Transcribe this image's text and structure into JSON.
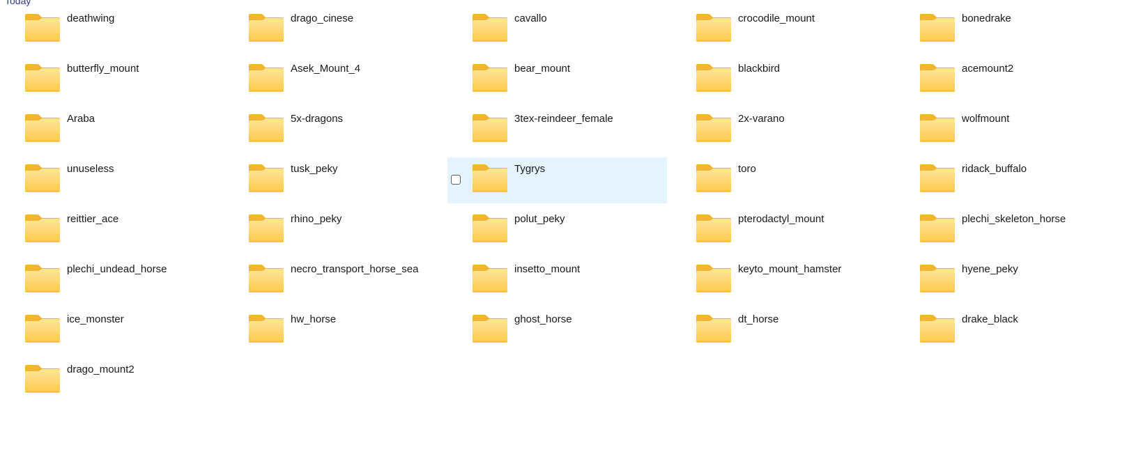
{
  "group": {
    "header": "Today"
  },
  "colors": {
    "folder_back": "#f2b52e",
    "folder_front_top": "#ffe69a",
    "folder_front_bottom": "#fcc94a",
    "selection_bg": "#e5f3fd",
    "header_text": "#2b3f8e"
  },
  "folders": [
    {
      "name": "deathwing"
    },
    {
      "name": "drago_cinese"
    },
    {
      "name": "cavallo"
    },
    {
      "name": "crocodile_mount"
    },
    {
      "name": "bonedrake"
    },
    {
      "name": "butterfly_mount"
    },
    {
      "name": "Asek_Mount_4"
    },
    {
      "name": "bear_mount"
    },
    {
      "name": "blackbird"
    },
    {
      "name": "acemount2"
    },
    {
      "name": "Araba"
    },
    {
      "name": "5x-dragons"
    },
    {
      "name": "3tex-reindeer_female"
    },
    {
      "name": "2x-varano"
    },
    {
      "name": "wolfmount"
    },
    {
      "name": "unuseless"
    },
    {
      "name": "tusk_peky"
    },
    {
      "name": "Tygrys",
      "selected": true
    },
    {
      "name": "toro"
    },
    {
      "name": "ridack_buffalo"
    },
    {
      "name": "reittier_ace"
    },
    {
      "name": "rhino_peky"
    },
    {
      "name": "polut_peky"
    },
    {
      "name": "pterodactyl_mount"
    },
    {
      "name": "plechi_skeleton_horse"
    },
    {
      "name": "plechi_undead_horse"
    },
    {
      "name": "necro_transport_horse_sea"
    },
    {
      "name": "insetto_mount"
    },
    {
      "name": "keyto_mount_hamster"
    },
    {
      "name": "hyene_peky"
    },
    {
      "name": "ice_monster"
    },
    {
      "name": "hw_horse"
    },
    {
      "name": "ghost_horse"
    },
    {
      "name": "dt_horse"
    },
    {
      "name": "drake_black"
    },
    {
      "name": "drago_mount2"
    }
  ]
}
